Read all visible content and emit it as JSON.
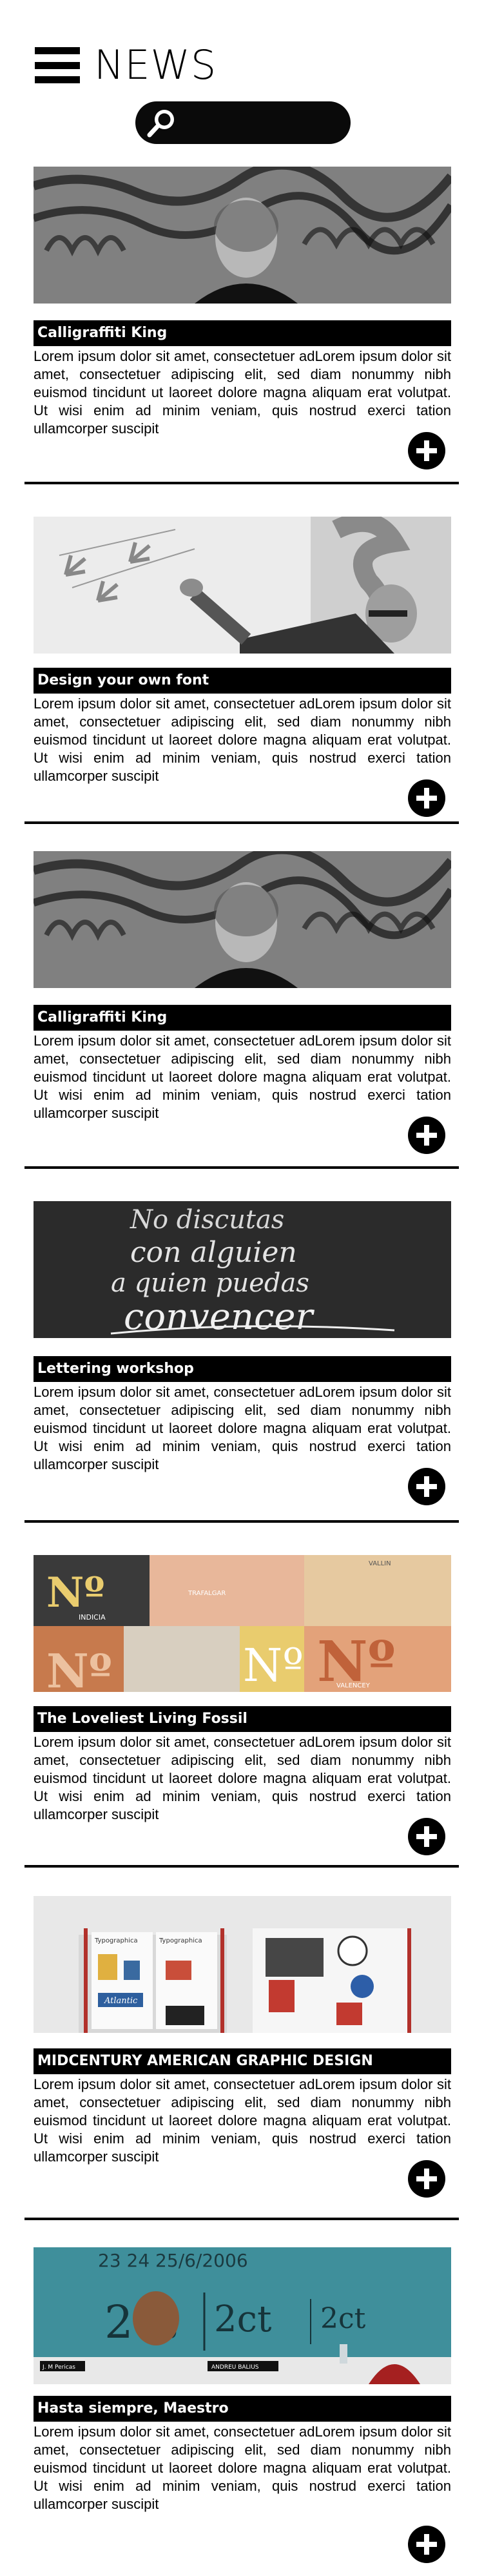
{
  "header": {
    "title": "NEWS",
    "menu_icon": "hamburger-menu-icon"
  },
  "search": {
    "icon": "search-icon",
    "placeholder": "",
    "value": ""
  },
  "articles": [
    {
      "title": "Calligraffiti King",
      "image": "calligraffiti-portrait",
      "body": "Lorem ipsum dolor sit amet, consectetuer adLorem ipsum dolor sit amet, consectetuer adipiscing elit, sed diam nonummy nibh euismod tincidunt ut laoreet dolore magna aliquam erat volutpat. Ut wisi enim ad minim veniam, quis nostrud exerci tation ullamcorper suscipit",
      "action_icon": "plus-circle-icon"
    },
    {
      "title": "Design your own font",
      "image": "font-design-lecture",
      "body": "Lorem ipsum dolor sit amet, consectetuer adLorem ipsum dolor sit amet, consectetuer adipiscing elit, sed diam nonummy nibh euismod tincidunt ut laoreet dolore magna aliquam erat volutpat. Ut wisi enim ad minim veniam, quis nostrud exerci tation ullamcorper suscipit",
      "action_icon": "plus-circle-icon"
    },
    {
      "title": "Calligraffiti King",
      "image": "calligraffiti-portrait",
      "body": "Lorem ipsum dolor sit amet, consectetuer adLorem ipsum dolor sit amet, consectetuer adipiscing elit, sed diam nonummy nibh euismod tincidunt ut laoreet dolore magna aliquam erat volutpat. Ut wisi enim ad minim veniam, quis nostrud exerci tation ullamcorper suscipit",
      "action_icon": "plus-circle-icon"
    },
    {
      "title": "Lettering workshop",
      "image": "lettering-chalkboard",
      "image_text": [
        "No discutas",
        "con alguien",
        "a quien puedas",
        "convencer"
      ],
      "body": "Lorem ipsum dolor sit amet, consectetuer adLorem ipsum dolor sit amet, consectetuer adipiscing elit, sed diam nonummy nibh euismod tincidunt ut laoreet dolore magna aliquam erat volutpat. Ut wisi enim ad minim veniam, quis nostrud exerci tation ullamcorper suscipit",
      "action_icon": "plus-circle-icon"
    },
    {
      "title": "The Loveliest Living Fossil",
      "image": "numero-sign-collage",
      "image_text": [
        "Nº",
        "INDICIA",
        "TRAFALGAR",
        "VALLIN",
        "VALENCEY"
      ],
      "body": "Lorem ipsum dolor sit amet, consectetuer adLorem ipsum dolor sit amet, consectetuer adipiscing elit, sed diam nonummy nibh euismod tincidunt ut laoreet dolore magna aliquam erat volutpat. Ut wisi enim ad minim veniam, quis nostrud exerci tation ullamcorper suscipit",
      "action_icon": "plus-circle-icon"
    },
    {
      "title": "MIDCENTURY AMERICAN GRAPHIC DESIGN",
      "image": "midcentury-books",
      "image_text": [
        "Typographica",
        "Typographica",
        "Atlantic"
      ],
      "body": "Lorem ipsum dolor sit amet, consectetuer adLorem ipsum dolor sit amet, consectetuer adipiscing elit, sed diam nonummy nibh euismod tincidunt ut laoreet dolore magna aliquam erat volutpat. Ut wisi enim ad minim veniam, quis nostrud exerci tation ullamcorper suscipit",
      "action_icon": "plus-circle-icon"
    },
    {
      "title": "Hasta siempre, Maestro",
      "image": "conference-speaker",
      "image_text": [
        "23 24 25/6/2006",
        "2ct",
        "2ct",
        "2ct",
        "J. M Pericas",
        "ANDREU BALIUS"
      ],
      "body": "Lorem ipsum dolor sit amet, consectetuer adLorem ipsum dolor sit amet, consectetuer adipiscing elit, sed diam nonummy nibh euismod tincidunt ut laoreet dolore magna aliquam erat volutpat. Ut wisi enim ad minim veniam, quis nostrud exerci tation ullamcorper suscipit",
      "action_icon": "plus-circle-icon"
    }
  ],
  "colors": {
    "title_bar": "#000000",
    "title_text": "#ffffff",
    "search_bg": "#0a0a0a",
    "divider": "#000000"
  }
}
